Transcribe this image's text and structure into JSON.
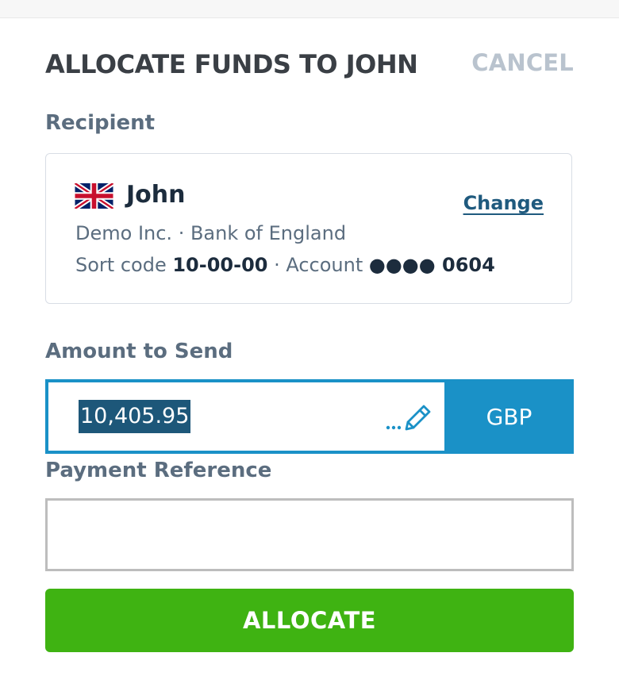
{
  "header": {
    "title": "ALLOCATE FUNDS TO JOHN",
    "cancel_label": "CANCEL"
  },
  "recipient": {
    "section_label": "Recipient",
    "flag_icon": "uk-flag-icon",
    "name": "John",
    "change_label": "Change",
    "company": "Demo Inc.",
    "separator": " · ",
    "bank": "Bank of England",
    "sort_code_label": "Sort code",
    "sort_code": "10-00-00",
    "account_label": "Account",
    "account_masked": "●●●● 0604"
  },
  "amount": {
    "section_label": "Amount to Send",
    "value": "10,405.95",
    "edit_icon": "pencil-icon",
    "currency": "GBP"
  },
  "reference": {
    "section_label": "Payment Reference",
    "value": "",
    "placeholder": ""
  },
  "actions": {
    "allocate_label": "ALLOCATE"
  },
  "colors": {
    "accent_blue": "#1a91c7",
    "selection": "#1d5779",
    "primary_green": "#3fb312",
    "label_gray": "#5b6d7f",
    "cancel_gray": "#b9c3ce"
  }
}
